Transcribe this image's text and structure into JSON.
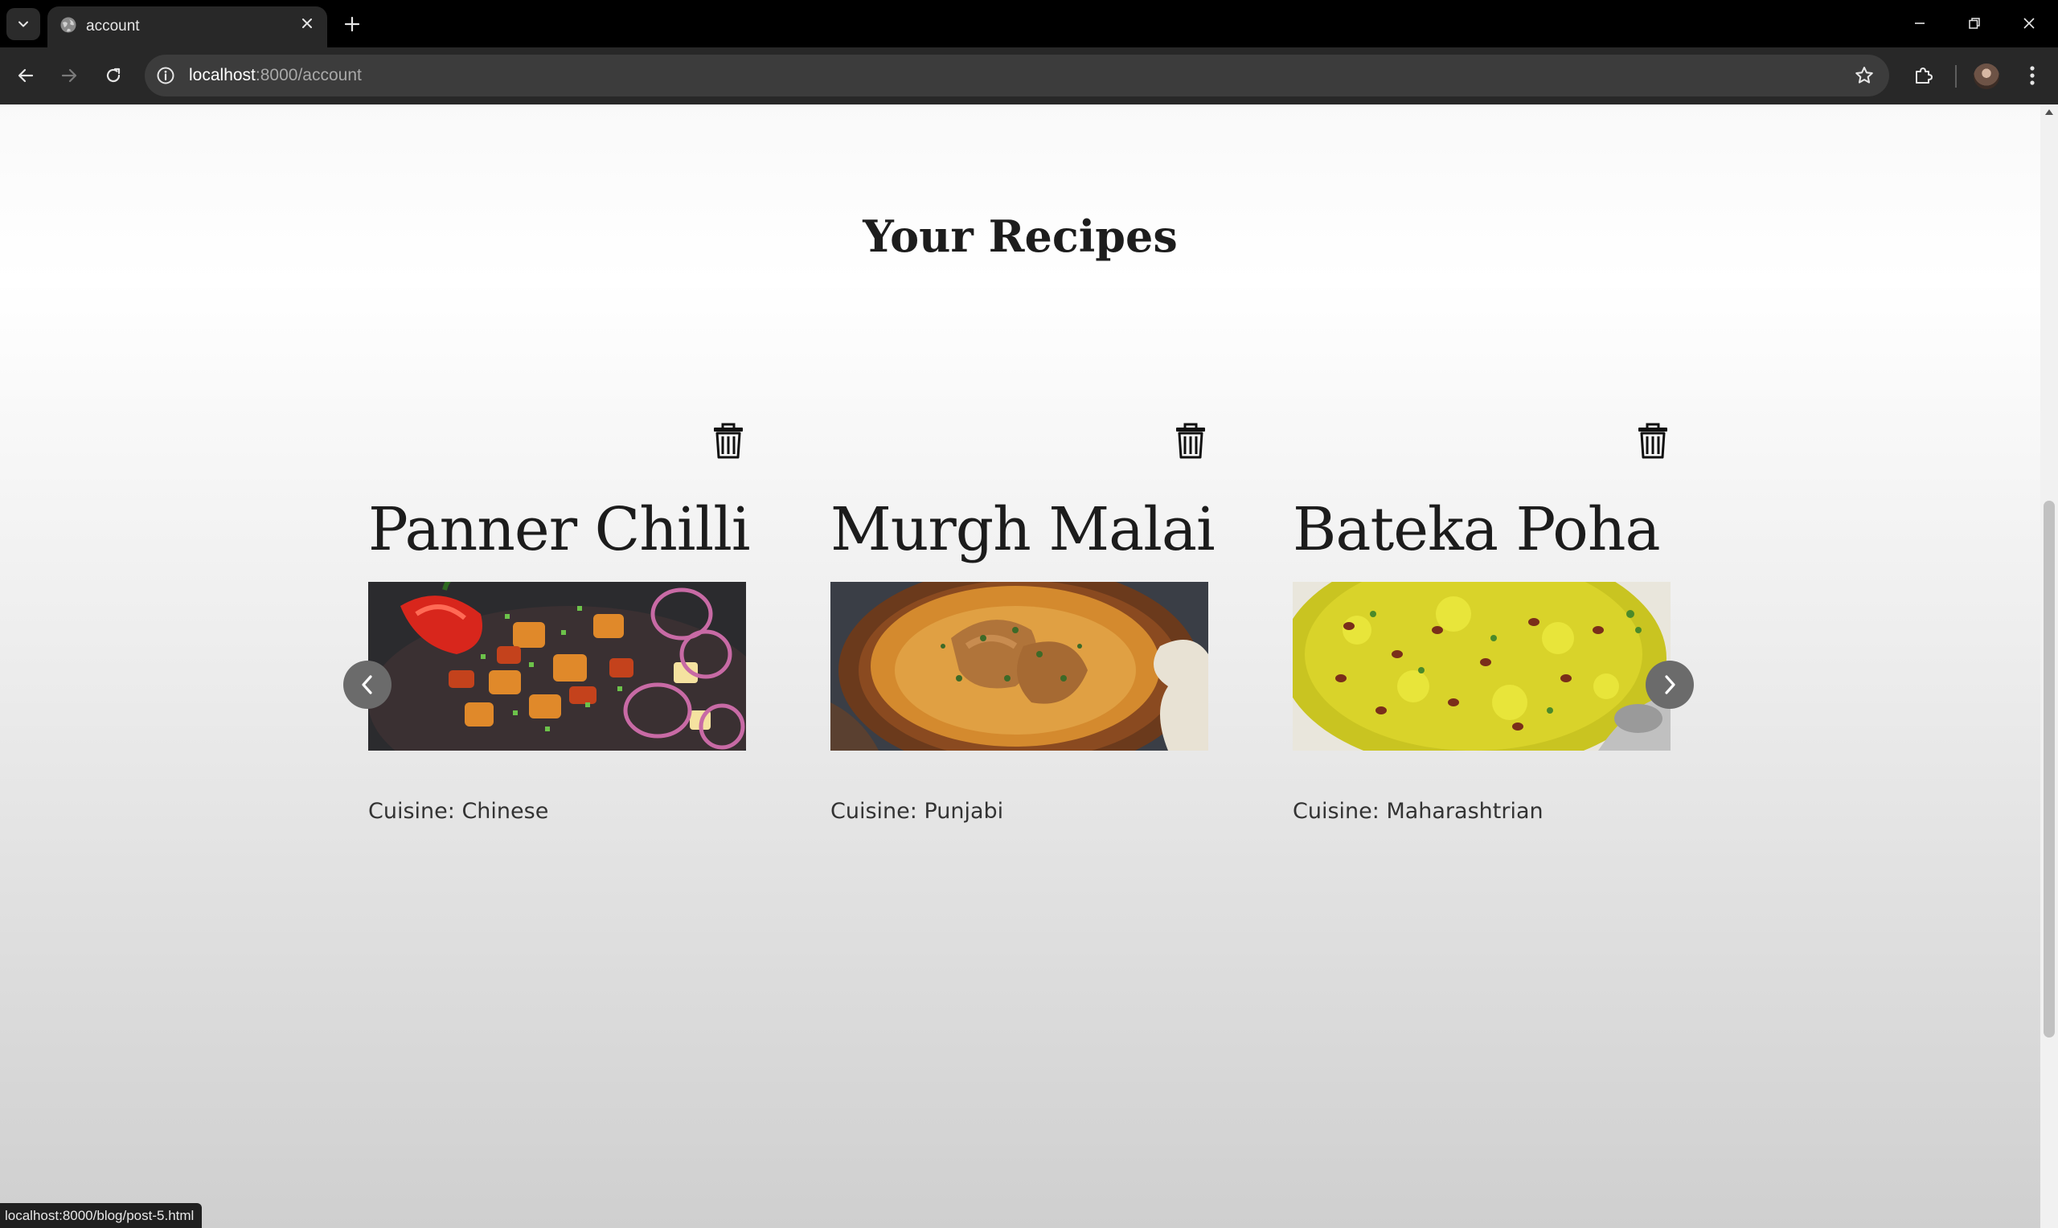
{
  "browser": {
    "tab_title": "account",
    "url_host": "localhost",
    "url_path": ":8000/account",
    "status_url": "localhost:8000/blog/post-5.html"
  },
  "page": {
    "section_title": "Your Recipes",
    "recipes": [
      {
        "title": "Panner Chilli",
        "cuisine": "Cuisine: Chinese"
      },
      {
        "title": "Murgh Malai",
        "cuisine": "Cuisine: Punjabi"
      },
      {
        "title": "Bateka Poha",
        "cuisine": "Cuisine: Maharashtrian"
      }
    ]
  },
  "colors": {
    "chrome_dark": "#000000",
    "toolbar": "#282828",
    "carousel_button": "#6b6b6b"
  },
  "icons": {
    "delete": "trash-icon",
    "prev": "chevron-left-icon",
    "next": "chevron-right-icon"
  }
}
